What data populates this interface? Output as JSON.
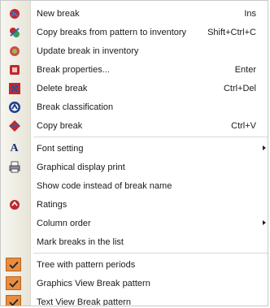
{
  "menu": {
    "items": [
      {
        "label": "New break",
        "shortcut": "Ins",
        "icon": "new-break-icon"
      },
      {
        "label": "Copy breaks from pattern to inventory",
        "shortcut": "Shift+Ctrl+C",
        "icon": "copy-pattern-icon"
      },
      {
        "label": "Update break in inventory",
        "shortcut": "",
        "icon": "update-break-icon"
      },
      {
        "label": "Break properties...",
        "shortcut": "Enter",
        "icon": "properties-icon"
      },
      {
        "label": "Delete break",
        "shortcut": "Ctrl+Del",
        "icon": "delete-break-icon"
      },
      {
        "label": "Break classification",
        "shortcut": "",
        "icon": "classification-icon"
      },
      {
        "label": "Copy break",
        "shortcut": "Ctrl+V",
        "icon": "copy-break-icon"
      },
      {
        "label": "Font setting",
        "shortcut": "",
        "icon": "font-icon",
        "submenu": true
      },
      {
        "label": "Graphical display print",
        "shortcut": "",
        "icon": "print-icon"
      },
      {
        "label": "Show code instead of break name",
        "shortcut": "",
        "icon": ""
      },
      {
        "label": "Ratings",
        "shortcut": "",
        "icon": "ratings-icon"
      },
      {
        "label": "Column order",
        "shortcut": "",
        "icon": "",
        "submenu": true
      },
      {
        "label": "Mark breaks in the list",
        "shortcut": "",
        "icon": ""
      },
      {
        "label": "Tree with pattern periods",
        "shortcut": "",
        "icon": "checkmark-icon",
        "checked": true
      },
      {
        "label": "Graphics View Break pattern",
        "shortcut": "",
        "icon": "checkmark-icon",
        "checked": true
      },
      {
        "label": "Text View Break pattern",
        "shortcut": "",
        "icon": "checkmark-icon",
        "checked": true
      }
    ]
  },
  "colors": {
    "gutter": "#ebe9de",
    "check_bg": "#e78d42",
    "separator": "#d8d8d8"
  }
}
